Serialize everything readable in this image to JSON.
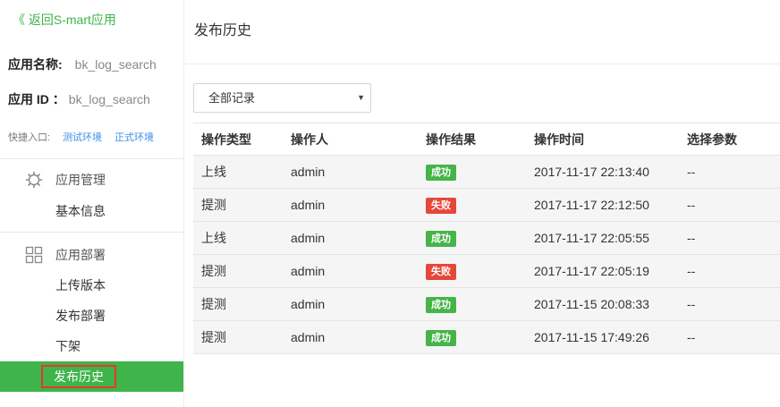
{
  "sidebar": {
    "back_link": "《 返回S-mart应用",
    "app_name_label": "应用名称:",
    "app_name_value": "bk_log_search",
    "app_id_label": "应用 ID ：",
    "app_id_value": "bk_log_search",
    "quick_entry_label": "快捷入口:",
    "quick_links": [
      "测试环境",
      "正式环境"
    ],
    "sections": [
      {
        "title": "应用管理",
        "icon": "gear-icon",
        "items": [
          "基本信息"
        ]
      },
      {
        "title": "应用部署",
        "icon": "grid-icon",
        "items": [
          "上传版本",
          "发布部署",
          "下架",
          "发布历史"
        ]
      }
    ],
    "active_item": "发布历史"
  },
  "main": {
    "title": "发布历史",
    "filter": {
      "selected": "全部记录"
    },
    "table": {
      "headers": [
        "操作类型",
        "操作人",
        "操作结果",
        "操作时间",
        "选择参数"
      ],
      "rows": [
        {
          "type": "上线",
          "operator": "admin",
          "result": "成功",
          "status": "success",
          "time": "2017-11-17 22:13:40",
          "params": "--"
        },
        {
          "type": "提测",
          "operator": "admin",
          "result": "失败",
          "status": "fail",
          "time": "2017-11-17 22:12:50",
          "params": "--"
        },
        {
          "type": "上线",
          "operator": "admin",
          "result": "成功",
          "status": "success",
          "time": "2017-11-17 22:05:55",
          "params": "--"
        },
        {
          "type": "提测",
          "operator": "admin",
          "result": "失败",
          "status": "fail",
          "time": "2017-11-17 22:05:19",
          "params": "--"
        },
        {
          "type": "提测",
          "operator": "admin",
          "result": "成功",
          "status": "success",
          "time": "2017-11-15 20:08:33",
          "params": "--"
        },
        {
          "type": "提测",
          "operator": "admin",
          "result": "成功",
          "status": "success",
          "time": "2017-11-15 17:49:26",
          "params": "--"
        }
      ]
    }
  },
  "colors": {
    "accent": "#3fb44b",
    "success": "#46b449",
    "fail": "#e5473b",
    "link": "#3a8ee6",
    "highlight_border": "#e33a2b"
  }
}
